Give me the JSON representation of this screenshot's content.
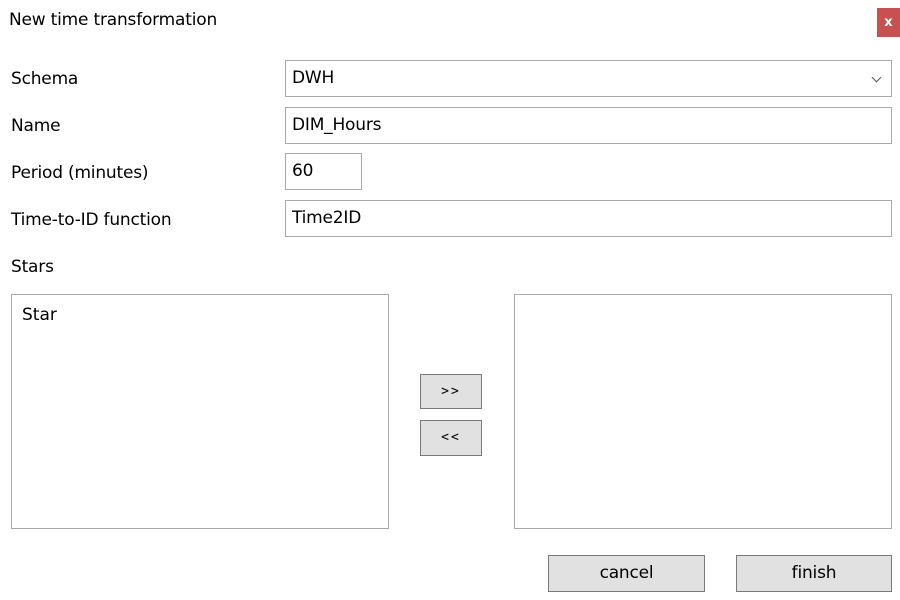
{
  "window": {
    "title": "New time transformation",
    "close_label": "x"
  },
  "form": {
    "schema": {
      "label": "Schema",
      "value": "DWH"
    },
    "name": {
      "label": "Name",
      "value": "DIM_Hours"
    },
    "period": {
      "label": "Period (minutes)",
      "value": "60"
    },
    "time_to_id": {
      "label": "Time-to-ID function",
      "value": "Time2ID"
    }
  },
  "stars": {
    "label": "Stars",
    "available": [
      "Star"
    ],
    "selected": []
  },
  "transfer": {
    "add_label": ">>",
    "remove_label": "<<"
  },
  "buttons": {
    "cancel": "cancel",
    "finish": "finish"
  },
  "colors": {
    "close_button": "#c75050",
    "button_face": "#e1e1e1",
    "border": "#a9a9a9"
  }
}
